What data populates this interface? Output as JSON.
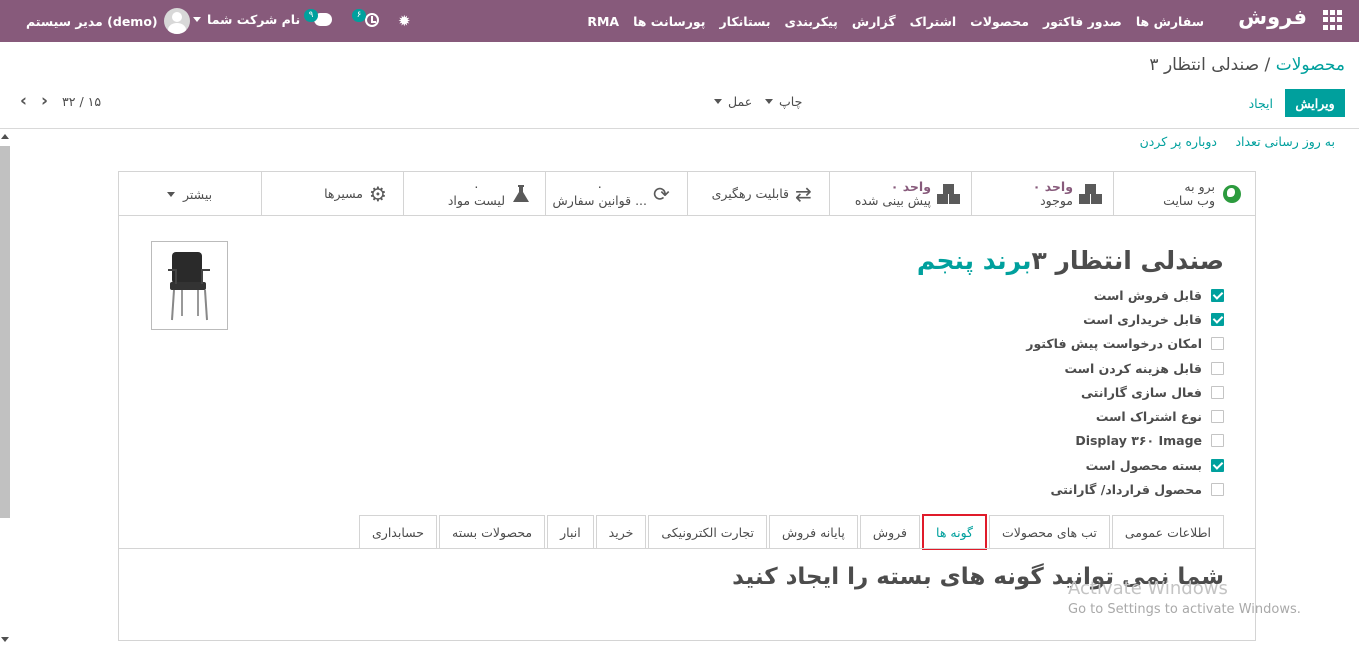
{
  "navbar": {
    "brand": "فروش",
    "menu": [
      "سفارش ها",
      "صدور فاکتور",
      "محصولات",
      "اشتراک",
      "گزارش",
      "پیکربندی",
      "بستانکار",
      "پورسانت ها",
      "RMA"
    ],
    "user": "مدیر سیستم (demo)",
    "company": "نام شرکت شما",
    "messages_count": "۹",
    "activities_count": "۶"
  },
  "control_panel": {
    "breadcrumb_parent": "محصولات",
    "breadcrumb_sep": "/",
    "breadcrumb_current": "صندلی انتظار ۳",
    "edit_label": "ویرایش",
    "create_label": "ایجاد",
    "print_label": "چاپ",
    "action_label": "عمل",
    "pager": "۱۵ / ۳۲"
  },
  "header_buttons": {
    "update_qty": "به روز رسانی تعداد",
    "replenish": "دوباره پر کردن"
  },
  "smart_buttons": [
    {
      "line1": "برو به",
      "line2": "وب سایت",
      "icon": "globe-icon"
    },
    {
      "line1": "۰ واحد",
      "line2": "موجود",
      "icon": "cubes-icon"
    },
    {
      "line1": "۰ واحد",
      "line2": "پیش بینی شده",
      "icon": "cubes-icon"
    },
    {
      "line1": "قابلیت رهگیری",
      "icon": "exchange-icon"
    },
    {
      "line1": "۰",
      "line2": "قوانین سفارش ...",
      "icon": "refresh-icon"
    },
    {
      "line1": "۰",
      "line2": "لیست مواد",
      "icon": "flask-icon"
    },
    {
      "line1": "مسیرها",
      "icon": "cogs-icon"
    },
    {
      "line1": "بیشتر",
      "icon": "caret-down-icon"
    }
  ],
  "product": {
    "name": "صندلی انتظار ۳",
    "brand": "برند پنجم"
  },
  "options": [
    {
      "label": "قابل فروش است",
      "checked": true
    },
    {
      "label": "قابل خریداری است",
      "checked": true
    },
    {
      "label": "امکان درخواست پیش فاکتور",
      "checked": false
    },
    {
      "label": "قابل هزینه کردن است",
      "checked": false
    },
    {
      "label": "فعال سازی گارانتی",
      "checked": false
    },
    {
      "label": "نوع اشتراک است",
      "checked": false
    },
    {
      "label": "Display ۳۶۰ Image",
      "checked": false
    },
    {
      "label": "بسته محصول است",
      "checked": true
    },
    {
      "label": "محصول قرارداد/ گارانتی",
      "checked": false
    }
  ],
  "tabs": [
    "اطلاعات عمومی",
    "تب های محصولات",
    "گونه ها",
    "فروش",
    "پایانه فروش",
    "تجارت الکترونیکی",
    "خرید",
    "انبار",
    "محصولات بسته",
    "حسابداری"
  ],
  "active_tab": "گونه ها",
  "variants_message": "شما نمی توانید گونه های بسته را ایجاد کنید",
  "watermark": {
    "line1": "Activate Windows",
    "line2": "Go to Settings to activate Windows."
  },
  "colors": {
    "navbar": "#875a7b",
    "accent": "#00a09d",
    "highlight": "#e01b2a"
  }
}
